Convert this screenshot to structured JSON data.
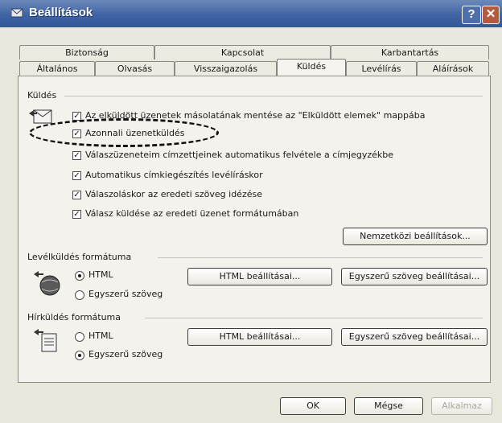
{
  "window": {
    "title": "Beállítások",
    "help_label": "?",
    "close_label": "✕"
  },
  "tabs_top": [
    "Biztonság",
    "Kapcsolat",
    "Karbantartás"
  ],
  "tabs_bottom": [
    "Általános",
    "Olvasás",
    "Visszaigazolás",
    "Küldés",
    "Levélírás",
    "Aláírások"
  ],
  "active_tab": "Küldés",
  "send_group": {
    "label": "Küldés",
    "options": [
      {
        "label": "Az elküldött üzenetek másolatának mentése az \"Elküldött elemek\" mappába",
        "checked": true
      },
      {
        "label": "Azonnali üzenetküldés",
        "checked": true
      },
      {
        "label": "Válaszüzeneteim címzettjeinek automatikus felvétele a címjegyzékbe",
        "checked": true
      },
      {
        "label": "Automatikus címkiegészítés levélíráskor",
        "checked": true
      },
      {
        "label": "Válaszoláskor az eredeti szöveg idézése",
        "checked": true
      },
      {
        "label": "Válasz küldése az eredeti üzenet formátumában",
        "checked": true
      }
    ],
    "intl_button": "Nemzetközi beállítások..."
  },
  "mail_format": {
    "label": "Levélküldés formátuma",
    "radio_html": "HTML",
    "radio_plain": "Egyszerű szöveg",
    "selected": "HTML",
    "html_button": "HTML beállításai...",
    "plain_button": "Egyszerű szöveg beállításai..."
  },
  "news_format": {
    "label": "Hírküldés formátuma",
    "radio_html": "HTML",
    "radio_plain": "Egyszerű szöveg",
    "selected": "Egyszerű szöveg",
    "html_button": "HTML beállításai...",
    "plain_button": "Egyszerű szöveg beállításai..."
  },
  "footer": {
    "ok": "OK",
    "cancel": "Mégse",
    "apply": "Alkalmaz"
  },
  "colors": {
    "titlebar": "#3f63a3",
    "close_button": "#b25b3e",
    "panel": "#f4f2ec",
    "dashed_annotation": "#111111"
  }
}
